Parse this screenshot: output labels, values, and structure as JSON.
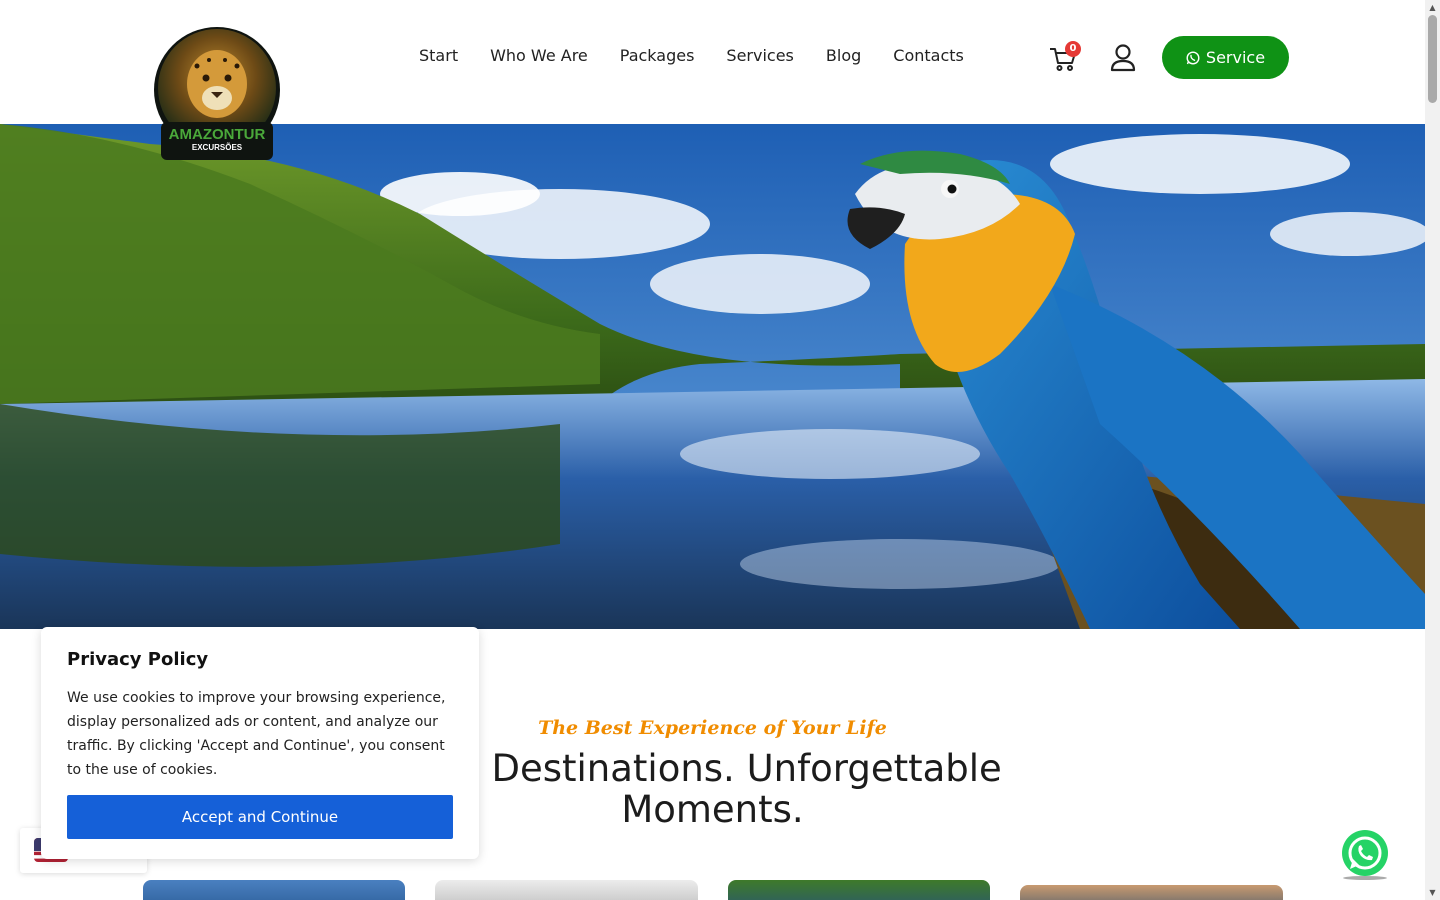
{
  "header": {
    "logo": {
      "brand": "AMAZONTUR",
      "sub": "EXCURSÕES"
    },
    "nav": [
      {
        "label": "Start"
      },
      {
        "label": "Who We Are"
      },
      {
        "label": "Packages"
      },
      {
        "label": "Services"
      },
      {
        "label": "Blog"
      },
      {
        "label": "Contacts"
      }
    ],
    "cart_count": "0",
    "service_button": "Service"
  },
  "section": {
    "eyebrow": "The Best Experience of Your Life",
    "headline_visible": "ble Destinations. Unforgettable Moments."
  },
  "privacy": {
    "title": "Privacy Policy",
    "text": "We use cookies to improve your browsing experience, display personalized ads or content, and analyze our traffic. By clicking 'Accept and Continue', you consent to the use of cookies.",
    "accept_button": "Accept and Continue"
  },
  "colors": {
    "brand_green": "#0f9215",
    "accent_orange": "#f08c00",
    "accept_blue": "#1560d8",
    "badge_red": "#e53935",
    "whatsapp_green": "#25d366"
  },
  "icons": [
    "cart-icon",
    "user-icon",
    "whatsapp-icon",
    "us-flag-icon",
    "whatsapp-float-icon"
  ]
}
